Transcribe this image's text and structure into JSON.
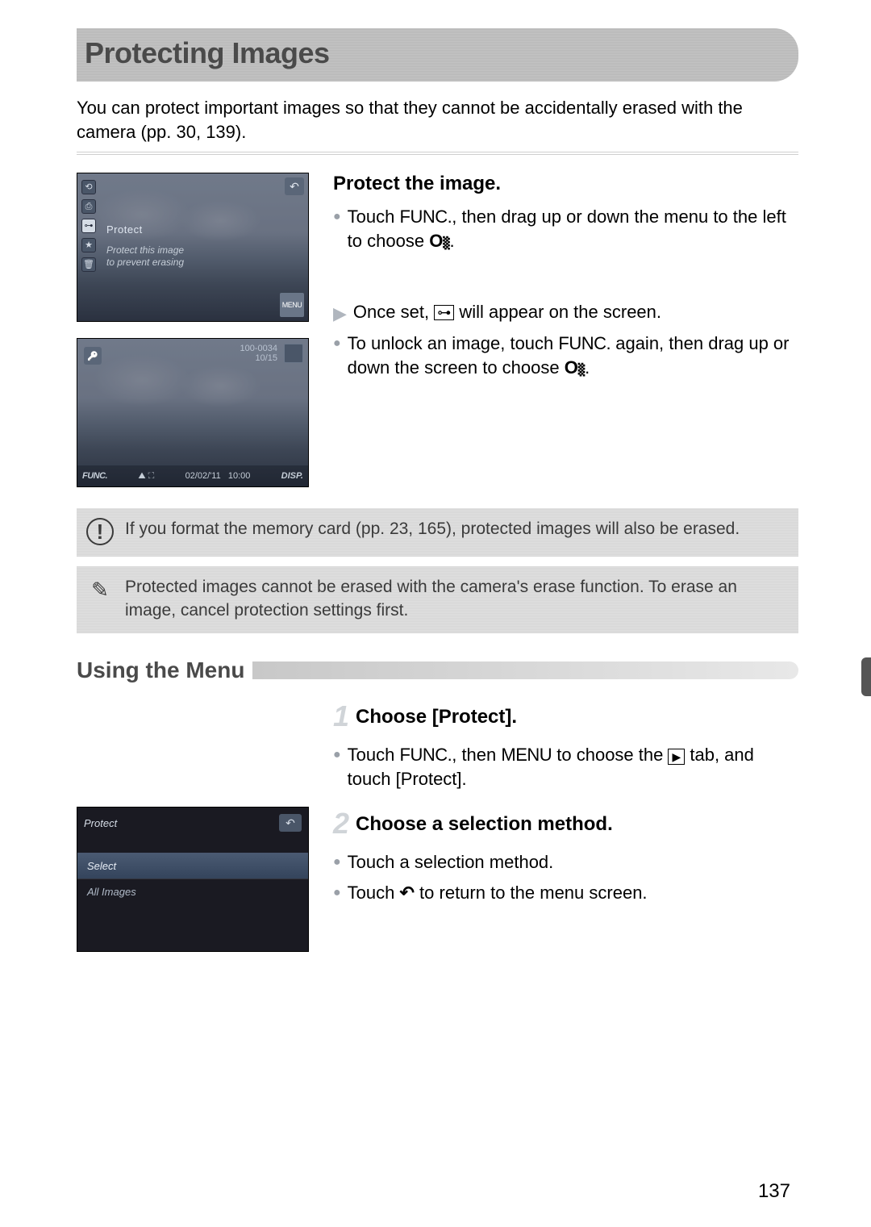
{
  "page": {
    "title": "Protecting Images",
    "intro": "You can protect important images so that they cannot be accidentally erased with the camera (pp. 30, 139).",
    "page_number": "137"
  },
  "screenshot1": {
    "label": "Protect",
    "caption_line1": "Protect this image",
    "caption_line2": "to prevent erasing",
    "menu_btn": "MENU"
  },
  "screenshot2": {
    "file_id": "100-0034",
    "counter": "10/15",
    "func_label": "FUNC.",
    "date": "02/02/'11",
    "time": "10:00",
    "disp_btn": "DISP."
  },
  "instructions1": {
    "heading": "Protect the image.",
    "b1_pre": "Touch ",
    "b1_func": "FUNC.",
    "b1_post": ", then drag up or down the menu to the left to choose ",
    "b2_pre": "Once set, ",
    "b2_post": " will appear on the screen.",
    "b3_pre": "To unlock an image, touch ",
    "b3_func": "FUNC.",
    "b3_mid": " again, then drag up or down the screen to choose "
  },
  "callouts": {
    "warn": "If you format the memory card (pp. 23, 165), protected images will also be erased.",
    "note": "Protected images cannot be erased with the camera's erase function. To erase an image, cancel protection settings first."
  },
  "section2": {
    "title": "Using the Menu"
  },
  "step1": {
    "heading": "Choose [Protect].",
    "b1_pre": "Touch ",
    "b1_func": "FUNC.",
    "b1_mid": ", then ",
    "b1_menu": "MENU",
    "b1_post1": " to choose the ",
    "b1_post2": " tab, and touch [Protect]."
  },
  "screenshot3": {
    "title": "Protect",
    "row1": "Select",
    "row2": "All Images"
  },
  "step2": {
    "heading": "Choose a selection method.",
    "b1": "Touch a selection method.",
    "b2_pre": "Touch ",
    "b2_post": " to return to the menu screen."
  }
}
